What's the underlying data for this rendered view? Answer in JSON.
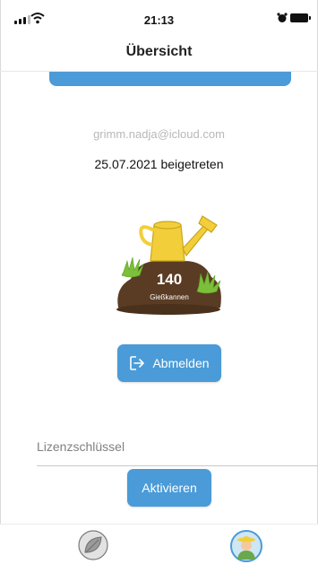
{
  "status_bar": {
    "time": "21:13"
  },
  "header": {
    "title": "Übersicht"
  },
  "profile": {
    "email": "grimm.nadja@icloud.com",
    "joined": "25.07.2021 beigetreten",
    "watering_cans_count": "140",
    "watering_cans_label": "Gießkannen"
  },
  "actions": {
    "logout_label": "Abmelden"
  },
  "license": {
    "label": "Lizenzschlüssel",
    "activate_label": "Aktivieren"
  },
  "tabbar": {
    "tabs": [
      {
        "icon": "leaf-icon"
      },
      {
        "icon": "gardener-avatar-icon"
      }
    ]
  },
  "colors": {
    "accent": "#4a9bd8",
    "text_muted": "#b8b8b8"
  }
}
